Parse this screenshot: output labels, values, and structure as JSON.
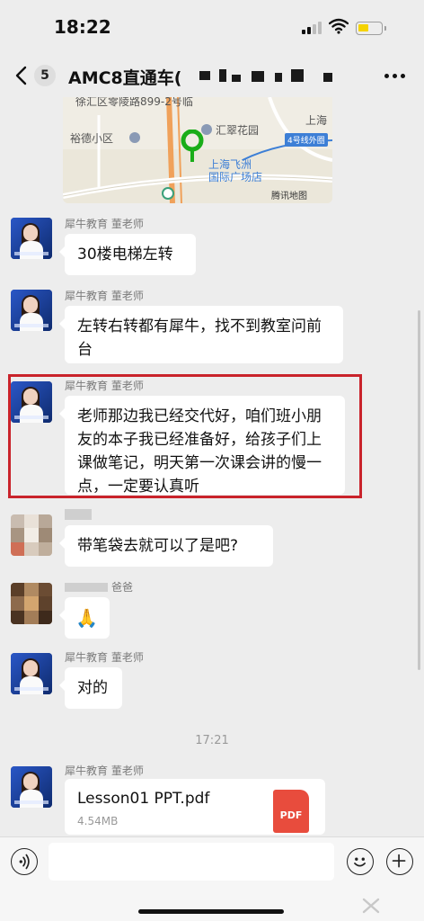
{
  "status_bar": {
    "time": "18:22"
  },
  "nav": {
    "unread_count": "5",
    "title": "AMC8直通车",
    "title_suffix": "(",
    "more_icon": "more-dots-icon"
  },
  "map": {
    "labels": {
      "top_partial": "徐汇区零陵路899-2号临",
      "yude": "裕德小区",
      "huicui": "汇翠花园",
      "shanghai": "上海",
      "line4": "4号线外圈",
      "destination_1": "上海飞洲",
      "destination_2": "国际广场店",
      "provider": "腾讯地图"
    },
    "colors": {
      "road": "#f0a15a",
      "pin": "#1aad19",
      "line": "#3d7fd6"
    }
  },
  "messages": [
    {
      "sender": "犀牛教育 董老师",
      "text": "30楼电梯左转"
    },
    {
      "sender": "犀牛教育 董老师",
      "text": "左转右转都有犀牛，找不到教室问前台"
    },
    {
      "sender": "犀牛教育 董老师",
      "text": "老师那边我已经交代好，咱们班小朋友的本子我已经准备好，给孩子们上课做笔记，明天第一次课会讲的慢一点，一定要认真听"
    },
    {
      "sender": "",
      "text": "带笔袋去就可以了是吧?"
    },
    {
      "sender": "爸爸",
      "text": "🙏"
    },
    {
      "sender": "犀牛教育 董老师",
      "text": "对的"
    }
  ],
  "divider_time": "17:21",
  "file_message": {
    "sender": "犀牛教育 董老师",
    "file_name": "Lesson01 PPT.pdf",
    "file_size": "4.54MB",
    "file_type": "PDF"
  },
  "input": {
    "placeholder": ""
  },
  "highlight_color": "#c9232b"
}
